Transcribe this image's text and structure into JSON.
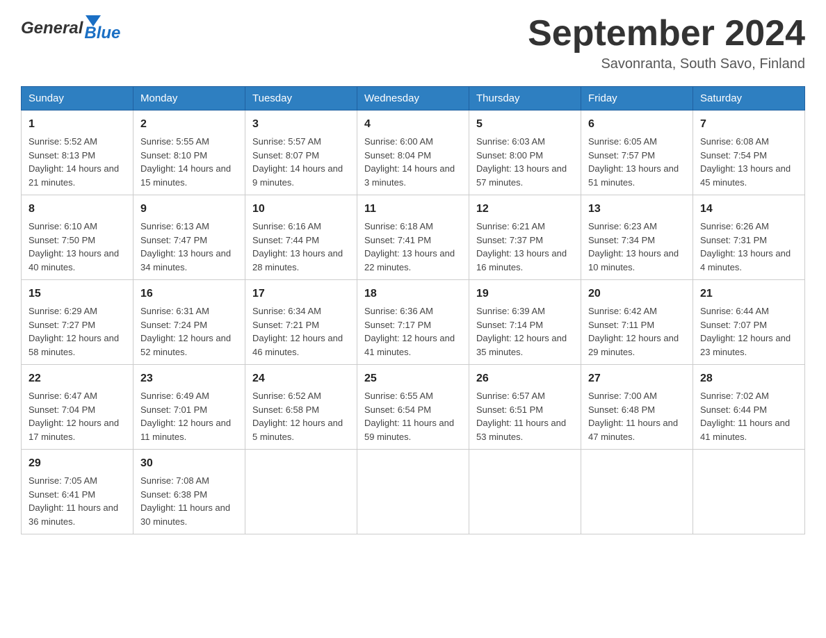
{
  "header": {
    "logo_general": "General",
    "logo_blue": "Blue",
    "title": "September 2024",
    "subtitle": "Savonranta, South Savo, Finland"
  },
  "days_of_week": [
    "Sunday",
    "Monday",
    "Tuesday",
    "Wednesday",
    "Thursday",
    "Friday",
    "Saturday"
  ],
  "weeks": [
    [
      {
        "day": "1",
        "sunrise": "5:52 AM",
        "sunset": "8:13 PM",
        "daylight": "14 hours and 21 minutes."
      },
      {
        "day": "2",
        "sunrise": "5:55 AM",
        "sunset": "8:10 PM",
        "daylight": "14 hours and 15 minutes."
      },
      {
        "day": "3",
        "sunrise": "5:57 AM",
        "sunset": "8:07 PM",
        "daylight": "14 hours and 9 minutes."
      },
      {
        "day": "4",
        "sunrise": "6:00 AM",
        "sunset": "8:04 PM",
        "daylight": "14 hours and 3 minutes."
      },
      {
        "day": "5",
        "sunrise": "6:03 AM",
        "sunset": "8:00 PM",
        "daylight": "13 hours and 57 minutes."
      },
      {
        "day": "6",
        "sunrise": "6:05 AM",
        "sunset": "7:57 PM",
        "daylight": "13 hours and 51 minutes."
      },
      {
        "day": "7",
        "sunrise": "6:08 AM",
        "sunset": "7:54 PM",
        "daylight": "13 hours and 45 minutes."
      }
    ],
    [
      {
        "day": "8",
        "sunrise": "6:10 AM",
        "sunset": "7:50 PM",
        "daylight": "13 hours and 40 minutes."
      },
      {
        "day": "9",
        "sunrise": "6:13 AM",
        "sunset": "7:47 PM",
        "daylight": "13 hours and 34 minutes."
      },
      {
        "day": "10",
        "sunrise": "6:16 AM",
        "sunset": "7:44 PM",
        "daylight": "13 hours and 28 minutes."
      },
      {
        "day": "11",
        "sunrise": "6:18 AM",
        "sunset": "7:41 PM",
        "daylight": "13 hours and 22 minutes."
      },
      {
        "day": "12",
        "sunrise": "6:21 AM",
        "sunset": "7:37 PM",
        "daylight": "13 hours and 16 minutes."
      },
      {
        "day": "13",
        "sunrise": "6:23 AM",
        "sunset": "7:34 PM",
        "daylight": "13 hours and 10 minutes."
      },
      {
        "day": "14",
        "sunrise": "6:26 AM",
        "sunset": "7:31 PM",
        "daylight": "13 hours and 4 minutes."
      }
    ],
    [
      {
        "day": "15",
        "sunrise": "6:29 AM",
        "sunset": "7:27 PM",
        "daylight": "12 hours and 58 minutes."
      },
      {
        "day": "16",
        "sunrise": "6:31 AM",
        "sunset": "7:24 PM",
        "daylight": "12 hours and 52 minutes."
      },
      {
        "day": "17",
        "sunrise": "6:34 AM",
        "sunset": "7:21 PM",
        "daylight": "12 hours and 46 minutes."
      },
      {
        "day": "18",
        "sunrise": "6:36 AM",
        "sunset": "7:17 PM",
        "daylight": "12 hours and 41 minutes."
      },
      {
        "day": "19",
        "sunrise": "6:39 AM",
        "sunset": "7:14 PM",
        "daylight": "12 hours and 35 minutes."
      },
      {
        "day": "20",
        "sunrise": "6:42 AM",
        "sunset": "7:11 PM",
        "daylight": "12 hours and 29 minutes."
      },
      {
        "day": "21",
        "sunrise": "6:44 AM",
        "sunset": "7:07 PM",
        "daylight": "12 hours and 23 minutes."
      }
    ],
    [
      {
        "day": "22",
        "sunrise": "6:47 AM",
        "sunset": "7:04 PM",
        "daylight": "12 hours and 17 minutes."
      },
      {
        "day": "23",
        "sunrise": "6:49 AM",
        "sunset": "7:01 PM",
        "daylight": "12 hours and 11 minutes."
      },
      {
        "day": "24",
        "sunrise": "6:52 AM",
        "sunset": "6:58 PM",
        "daylight": "12 hours and 5 minutes."
      },
      {
        "day": "25",
        "sunrise": "6:55 AM",
        "sunset": "6:54 PM",
        "daylight": "11 hours and 59 minutes."
      },
      {
        "day": "26",
        "sunrise": "6:57 AM",
        "sunset": "6:51 PM",
        "daylight": "11 hours and 53 minutes."
      },
      {
        "day": "27",
        "sunrise": "7:00 AM",
        "sunset": "6:48 PM",
        "daylight": "11 hours and 47 minutes."
      },
      {
        "day": "28",
        "sunrise": "7:02 AM",
        "sunset": "6:44 PM",
        "daylight": "11 hours and 41 minutes."
      }
    ],
    [
      {
        "day": "29",
        "sunrise": "7:05 AM",
        "sunset": "6:41 PM",
        "daylight": "11 hours and 36 minutes."
      },
      {
        "day": "30",
        "sunrise": "7:08 AM",
        "sunset": "6:38 PM",
        "daylight": "11 hours and 30 minutes."
      },
      null,
      null,
      null,
      null,
      null
    ]
  ],
  "labels": {
    "sunrise": "Sunrise:",
    "sunset": "Sunset:",
    "daylight": "Daylight:"
  }
}
